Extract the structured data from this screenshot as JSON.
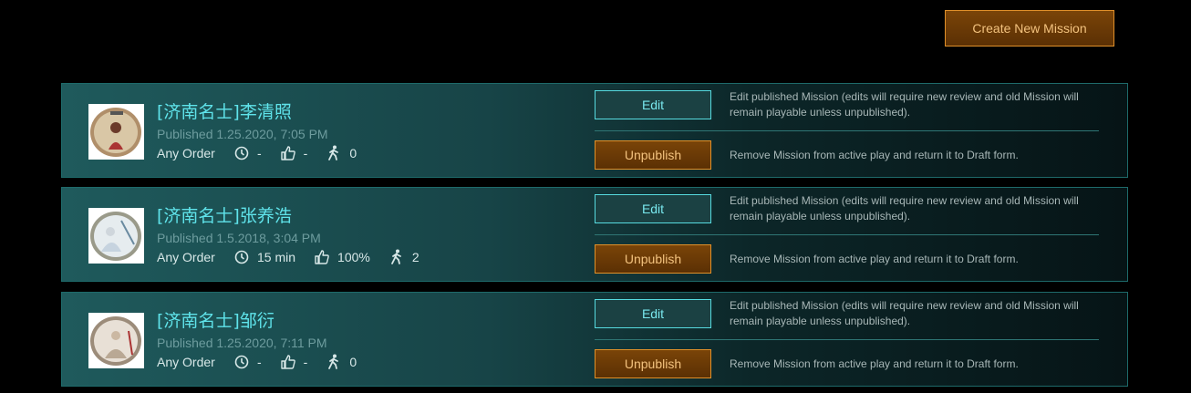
{
  "header": {
    "create_label": "Create New Mission"
  },
  "actions": {
    "edit_label": "Edit",
    "edit_desc": "Edit published Mission (edits will require new review and old Mission will remain playable unless unpublished).",
    "unpublish_label": "Unpublish",
    "unpublish_desc": "Remove Mission from active play and return it to Draft form."
  },
  "missions": [
    {
      "title": "[济南名士]李清照",
      "published": "Published 1.25.2020, 7:05 PM",
      "order": "Any Order",
      "time": "-",
      "rating": "-",
      "players": "0"
    },
    {
      "title": "[济南名士]张养浩",
      "published": "Published 1.5.2018, 3:04 PM",
      "order": "Any Order",
      "time": "15 min",
      "rating": "100%",
      "players": "2"
    },
    {
      "title": "[济南名士]邹衍",
      "published": "Published 1.25.2020, 7:11 PM",
      "order": "Any Order",
      "time": "-",
      "rating": "-",
      "players": "0"
    }
  ],
  "colors": {
    "accent_cyan": "#5fe3ea",
    "accent_orange": "#e0902a",
    "card_border": "#1e6a6a"
  },
  "icons": {
    "time": "clock-icon",
    "rating": "thumbs-up-icon",
    "players": "walking-person-icon"
  }
}
